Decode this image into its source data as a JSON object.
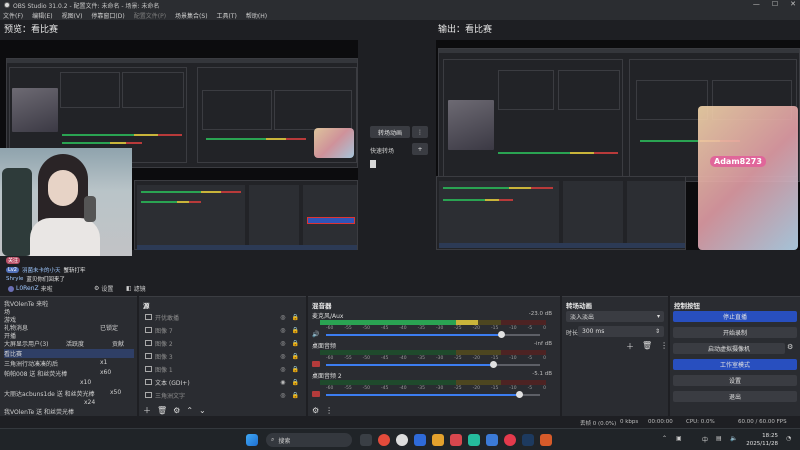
{
  "window": {
    "title": "OBS Studio 31.0.2 - 配置文件: 未命名 - 场景: 未命名",
    "controls": [
      "—",
      "☐",
      "✕"
    ]
  },
  "menu": [
    "文件(F)",
    "编辑(E)",
    "视图(V)",
    "停靠窗口(D)",
    "配置文件(P)",
    "场景集合(S)",
    "工具(T)",
    "帮助(H)"
  ],
  "preview": {
    "label": "预览：看比赛"
  },
  "program": {
    "label": "输出：看比赛",
    "overlay_name": "Adam8273"
  },
  "transition_col": {
    "button": "转场动画",
    "quick_label": "快速转场",
    "more": "⋮",
    "add": "+"
  },
  "webcam_chat": [
    {
      "tag": "关注",
      "name": "",
      "text": ""
    },
    {
      "tag": "Lv2",
      "name": "羽菌未卡的小天",
      "text": "蟹斩打牢"
    },
    {
      "tag": "",
      "name": "Shryle",
      "text": "蓝贝你们回来了"
    }
  ],
  "midbar": {
    "settings": "设置",
    "filters": "滤镜",
    "user": "L0RenZ",
    "user_msg": "来啦"
  },
  "left_dock": {
    "lines": [
      "我VOlenTe 来啦",
      "场",
      "游戏",
      "礼物消息",
      "开播",
      "大屏显示用户(3)",
      "看比赛",
      "三角洲行动凑凑的后",
      "帕帕008 送 和丝荧光棒",
      "大丽达acbuns1de 送 和丝荧光棒",
      "我VOlenTe 送 和丝荧光棒"
    ],
    "status_badge": "已锁定",
    "labels": [
      "活跃度",
      "贡献"
    ],
    "gift_counts": [
      "x1",
      "x60",
      "x10",
      "x50",
      "x24"
    ]
  },
  "sources": {
    "title": "源",
    "items": [
      {
        "label": "开优敢播",
        "dim": true
      },
      {
        "label": "图像 7",
        "dim": true
      },
      {
        "label": "图像 2",
        "dim": true
      },
      {
        "label": "图像 3",
        "dim": true
      },
      {
        "label": "图像 1",
        "dim": true
      },
      {
        "label": "文本 (GDI+)",
        "dim": false
      },
      {
        "label": "三角洲文字",
        "dim": true
      }
    ]
  },
  "mixer": {
    "title": "混音器",
    "channels": [
      {
        "name": "麦克风/Aux",
        "db": "-23.0 dB",
        "level": 0.7,
        "volume": 0.82
      },
      {
        "name": "桌面音频",
        "db": "-inf dB",
        "level": 0.0,
        "volume": 0.78
      },
      {
        "name": "桌面音频 2",
        "db": "-5.1 dB",
        "level": 0.0,
        "volume": 0.9
      }
    ],
    "scale": [
      "-60",
      "-55",
      "-50",
      "-45",
      "-40",
      "-35",
      "-30",
      "-25",
      "-20",
      "-15",
      "-10",
      "-5",
      "0"
    ]
  },
  "transitions": {
    "title": "转场动画",
    "selected": "淡入淡出",
    "duration_label": "时长",
    "duration": "300 ms"
  },
  "controls": {
    "title": "控制按钮",
    "buttons": [
      "停止直播",
      "开始录制",
      "启动虚拟摄像机",
      "工作室模式",
      "设置",
      "退出"
    ]
  },
  "status": {
    "dropped": "丢帧 0 (0.0%)",
    "live": "00:00:00",
    "rec": "00:00:00",
    "kbps": "0 kbps",
    "cpu": "CPU: 0.0%",
    "fps": "60.00 / 60.00 FPS"
  },
  "taskbar": {
    "search": "搜索",
    "ime": "中",
    "time": "18:25",
    "date": "2025/11/28"
  },
  "colors": {
    "accent": "#284fbf",
    "meter_green": "#2aa352",
    "meter_yellow": "#c9b43a",
    "meter_red": "#b83a3a"
  }
}
